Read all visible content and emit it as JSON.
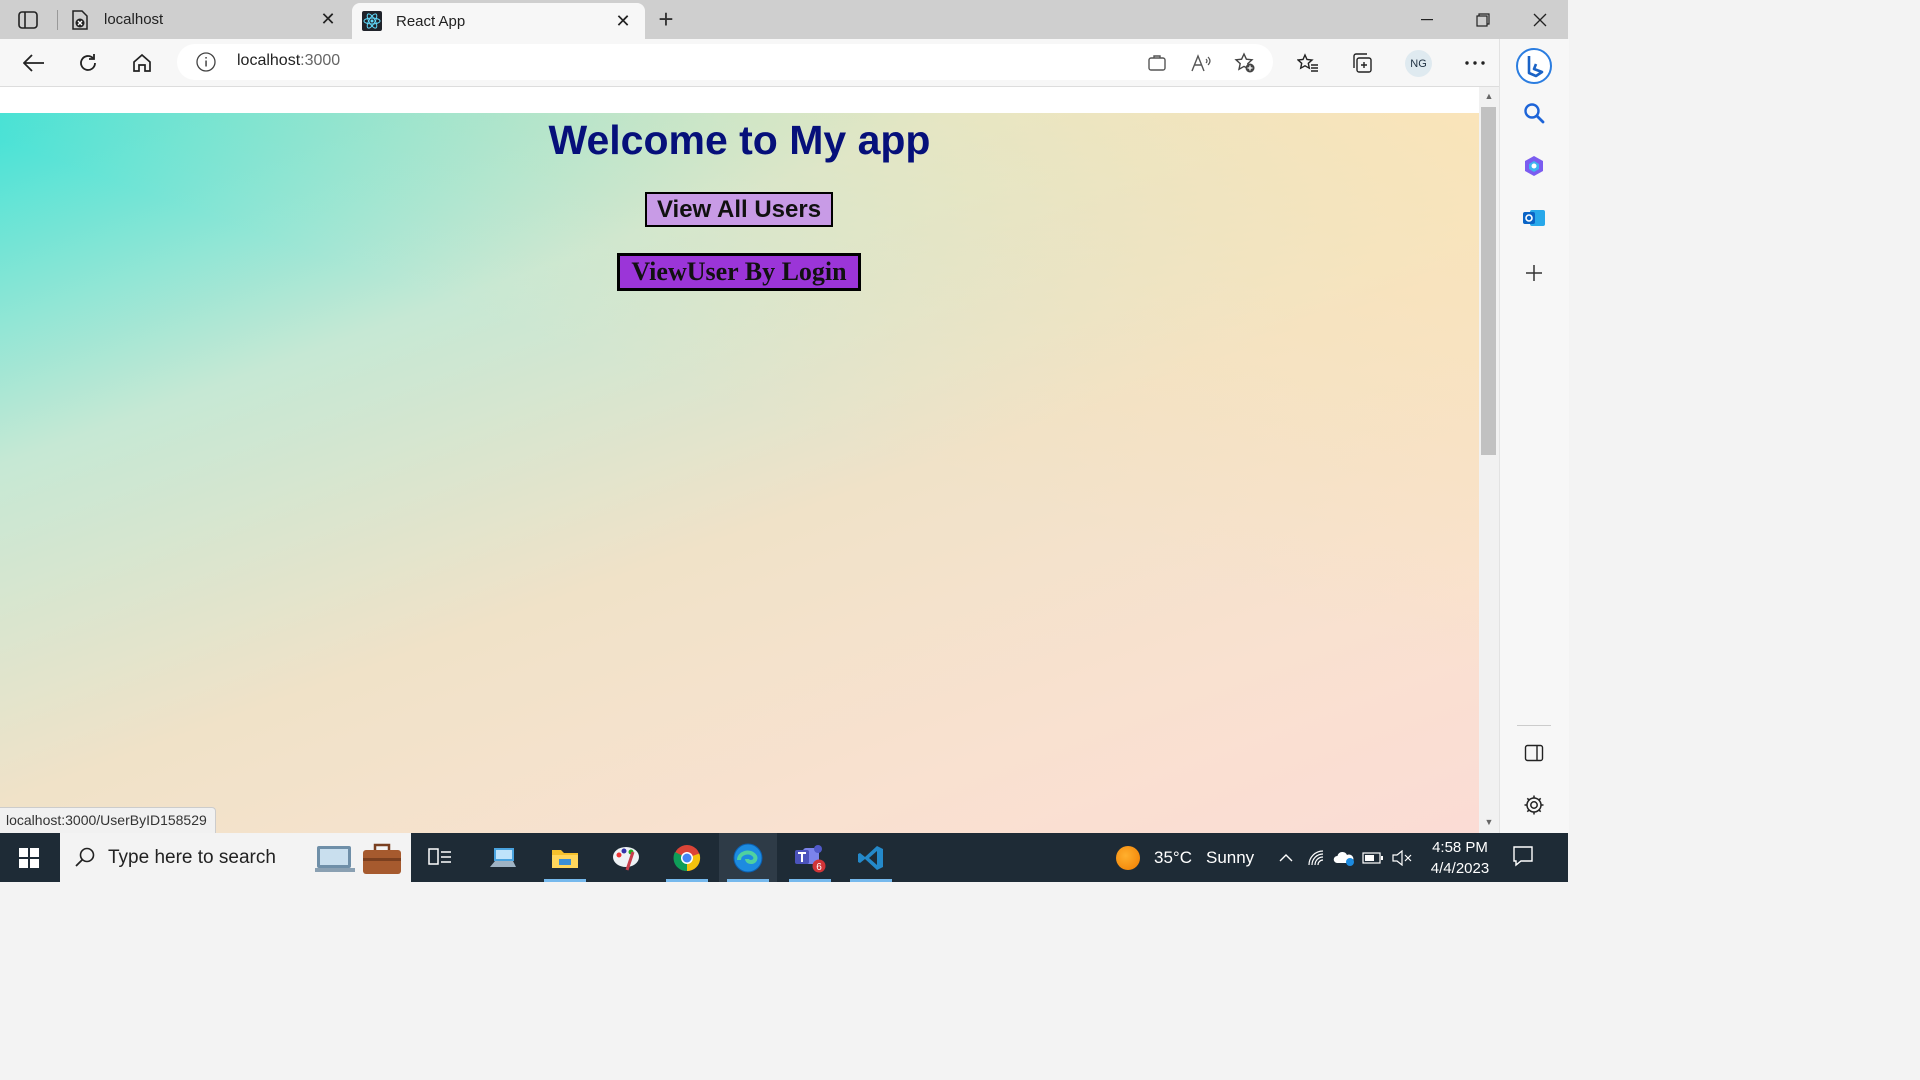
{
  "browser": {
    "tabs": [
      {
        "title": "localhost",
        "active": false
      },
      {
        "title": "React App",
        "active": true
      }
    ],
    "address": {
      "host": "localhost",
      "port": ":3000"
    },
    "profile_initials": "NG",
    "status_url": "localhost:3000/UserByID158529"
  },
  "page": {
    "heading": "Welcome to My app",
    "buttons": {
      "view_all": "View All Users",
      "view_by_login": "ViewUser By Login"
    },
    "colors": {
      "heading": "#06107a",
      "btn_view_all": "#c89be6",
      "btn_login": "#9b35d8"
    }
  },
  "taskbar": {
    "search_placeholder": "Type here to search",
    "weather": {
      "temp": "35°C",
      "condition": "Sunny"
    },
    "clock": {
      "time": "4:58 PM",
      "date": "4/4/2023"
    },
    "teams_badge": "6",
    "apps": [
      "task-view",
      "laptop",
      "file-explorer",
      "paint",
      "chrome",
      "edge",
      "teams",
      "vscode"
    ]
  }
}
